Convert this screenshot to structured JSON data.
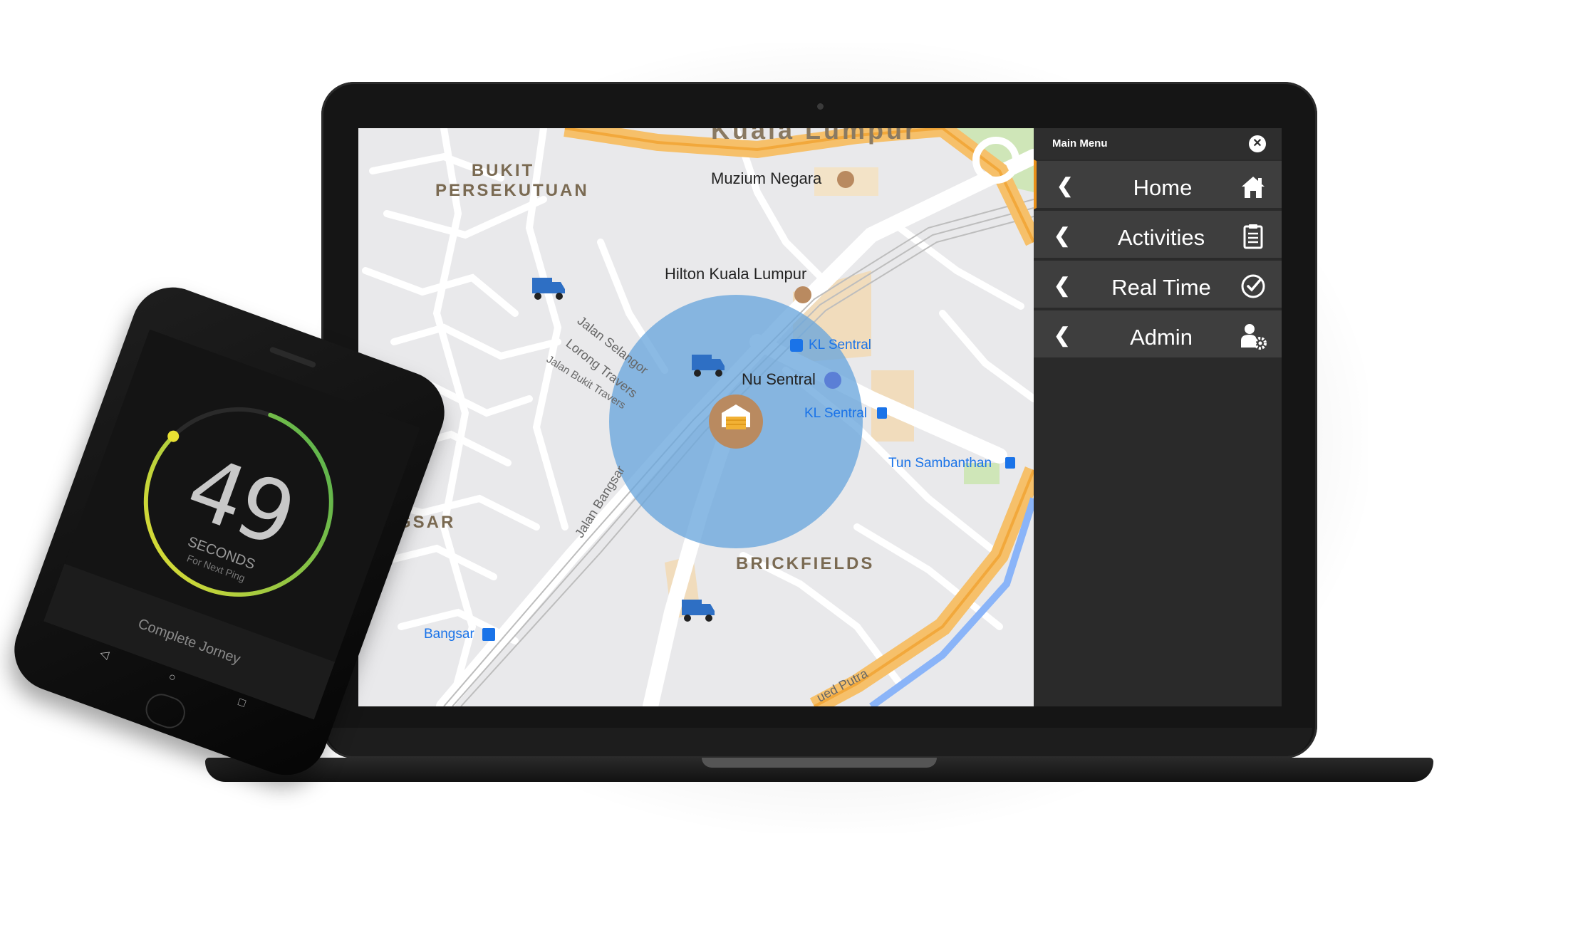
{
  "map": {
    "areas": [
      "BUKIT",
      "PERSEKUTUAN",
      "BANGSAR",
      "BRICKFIELDS"
    ],
    "top_label": "Kuala Lumpur",
    "pois": [
      "Muzium Negara",
      "Hilton Kuala Lumpur",
      "Nu Sentral"
    ],
    "transit": [
      "KL Sentral",
      "KL Sentral",
      "Tun Sambanthan",
      "Bangsar"
    ],
    "streets": [
      "Jalan Selangor",
      "Lorong Travers",
      "Jalan Bukit Travers",
      "Jalan Bangsar",
      "Jalan Tun Sambanthan Putra"
    ],
    "street_short": "ued Putra",
    "icons": [
      "truck-icon",
      "warehouse-icon",
      "museum-icon",
      "hotel-icon",
      "train-icon"
    ],
    "geofence_color": "#6aa6dc"
  },
  "menu": {
    "title": "Main Menu",
    "items": [
      {
        "label": "Home",
        "icon": "home-icon"
      },
      {
        "label": "Activities",
        "icon": "clipboard-icon"
      },
      {
        "label": "Real Time",
        "icon": "clock-check-icon"
      },
      {
        "label": "Admin",
        "icon": "admin-user-gear-icon"
      }
    ],
    "accent": "#e88f19"
  },
  "phone": {
    "countdown": "49",
    "unit": "SECONDS",
    "sub": "For Next Ping",
    "button": "Complete Jorney",
    "gauge_fraction": 0.82,
    "nav": [
      "◁",
      "○",
      "□"
    ]
  }
}
